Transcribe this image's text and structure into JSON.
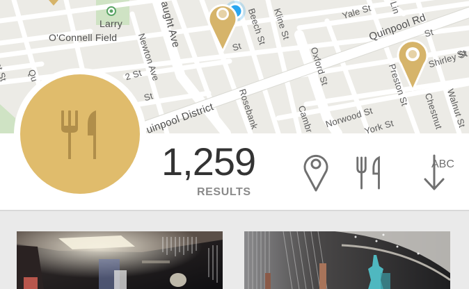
{
  "map": {
    "street_labels": {
      "quinpool_rd": "Quinpool Rd",
      "quinpool_district": "uinpool District",
      "oxford_st": "Oxford St",
      "yale_st": "Yale St",
      "beech_st": "Beech St",
      "kline_st": "Kline St",
      "newton_ave": "Newton Ave",
      "vaught_ave": "aught Ave",
      "rosebank": "Rosebank",
      "norwood_st": "Norwood St",
      "york_st": "York St",
      "preston_st": "Preston St",
      "chestnut": "Chestnut",
      "walnut_st": "Walnut St",
      "shirley_st": "Shirley St",
      "cambridge": "Cambr",
      "st_a": "St",
      "st_b": "St",
      "st_c": "St",
      "st_d": "St",
      "two_st": "2 St",
      "qu": "Qu",
      "lin": "Lin",
      "nt_st": "nt St"
    },
    "park_name_line1": "Larry",
    "park_name_line2": "O'Connell Field"
  },
  "results": {
    "count": "1,259",
    "label": "RESULTS"
  },
  "toolbar": {
    "sort_label": "ABC"
  },
  "category": {
    "name": "restaurants",
    "icon": "fork-knife-icon"
  },
  "colors": {
    "accent": "#e0bc6c",
    "pin": "#d6b46a",
    "icon_gray": "#707070",
    "location_blue": "#2aa6f0"
  },
  "cards": [
    {
      "name": "result-card-1"
    },
    {
      "name": "result-card-2"
    }
  ]
}
